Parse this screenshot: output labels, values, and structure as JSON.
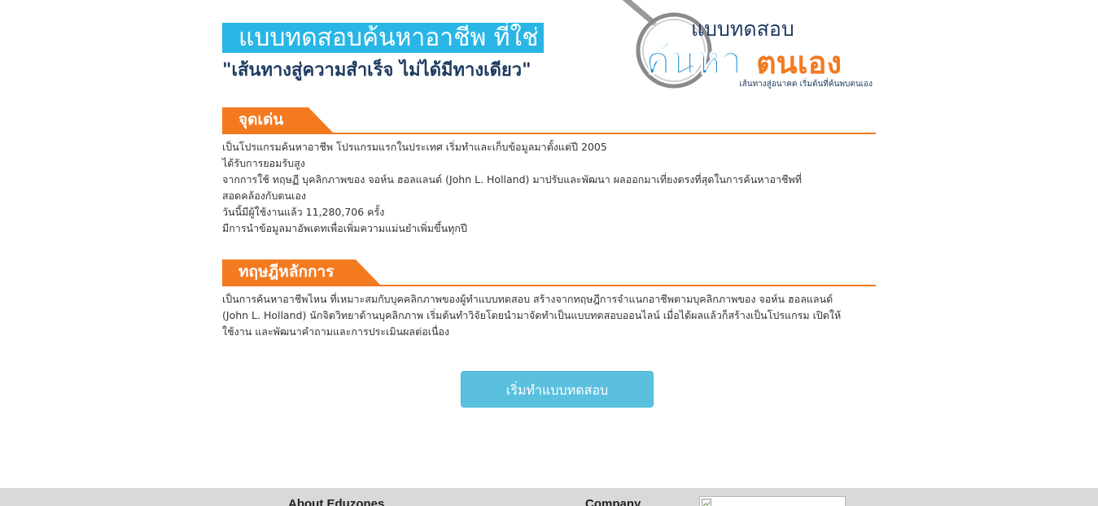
{
  "header": {
    "title": "แบบทดสอบค้นหาอาชีพ ที่ใช่",
    "subtitle": "\"เส้นทางสู่ความสำเร็จ ไม่ได้มีทางเดียว\""
  },
  "logo": {
    "line1": "แบบทดสอบ",
    "line2_blue": "ค้นหา",
    "line2_orange": "ตนเอง",
    "tagline": "เส้นทางสู่อนาคต เริ่มต้นที่ค้นพบตนเอง",
    "icon": "magnifier-icon",
    "colors": {
      "blue": "#1f8fd8",
      "orange": "#f47a20",
      "navy": "#1e3a5f"
    }
  },
  "highlights": {
    "heading": "จุดเด่น",
    "lines": [
      "เป็นโปรแกรมค้นหาอาชีพ โปรแกรมแรกในประเทศ เริ่มทำและเก็บข้อมูลมาตั้งแต่ปี 2005",
      "ได้รับการยอมรับสูง",
      "จากการใช้ ทฤษฏี บุคลิกภาพของ จอห์น ฮอลแลนด์ (John L. Holland) มาปรับและพัฒนา ผลออกมาเที่ยงตรงที่สุดในการค้นหาอาชีพที่",
      "สอดคล้องกับตนเอง",
      "วันนี้มีผู้ใช้งานแล้ว 11,280,706 ครั้ง",
      "มีการนำข้อมูลมาอัพเดทเพื่อเพิ่มความแม่นยำเพิ่มขึ้นทุกปี"
    ]
  },
  "theory": {
    "heading": "ทฤษฎีหลักการ",
    "lines": [
      "เป็นการค้นหาอาชีพไหน ที่เหมาะสมกับบุคคลิกภาพของผู้ทำแบบทดสอบ สร้างจากทฤษฎีการจำแนกอาชีพตามบุคลิกภาพของ จอห์น ฮอลแลนด์",
      "(John L. Holland) นักจิตวิทยาด้านบุคลิกภาพ เริ่มต้นทำวิจัยโดยนำมาจัดทำเป็นแบบทดสอบออนไลน์ เมื่อได้ผลแล้วก็สร้างเป็นโปรแกรม เปิดให้",
      "ใช้งาน และพัฒนาคำถามและการประเมินผลต่อเนื่อง"
    ]
  },
  "actions": {
    "start_label": "เริ่มทำแบบทดสอบ"
  },
  "footer": {
    "about_heading": "About Eduzones",
    "company_heading": "Company"
  },
  "colors": {
    "banner_blue": "#29b6e6",
    "section_orange": "#f47a20",
    "button_blue": "#5bc0de",
    "footer_gray": "#d9d9d9"
  }
}
